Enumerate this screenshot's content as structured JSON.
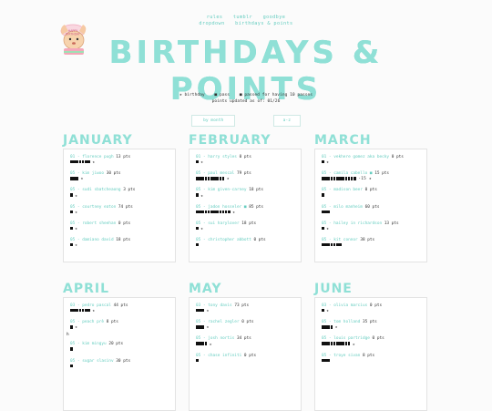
{
  "nav": {
    "row1": [
      "rules",
      "tumblr",
      "goodbye"
    ],
    "row2": [
      "dropdown",
      "birthdays & points"
    ]
  },
  "title": "BIRTHDAYS & POINTS",
  "legend": {
    "items": [
      "★ birthday",
      "■ pass",
      "■ passed for having 10 passes"
    ],
    "updated": "points updated as of: 01/26"
  },
  "buttons": [
    "by month",
    "a-z"
  ],
  "months": [
    {
      "name": "JANUARY",
      "entries": [
        {
          "date": "01",
          "name": "florence pugh",
          "pts": "13 pts",
          "squares": 7,
          "extra": "★"
        },
        {
          "date": "05",
          "name": "kim jiwoo",
          "pts": "30 pts",
          "squares": 3,
          "extra": "★"
        },
        {
          "date": "05",
          "name": "sudi sbatcheaong",
          "pts": "3 pts",
          "squares": 1,
          "extra": "★"
        },
        {
          "date": "05",
          "name": "courtney eaton",
          "pts": "74 pts",
          "squares": 1,
          "extra": "★"
        },
        {
          "date": "05",
          "name": "robert sheehan",
          "pts": "0 pts",
          "squares": 1,
          "extra": "★"
        },
        {
          "date": "05",
          "name": "damiano david",
          "pts": "18 pts",
          "squares": 1,
          "extra": "★"
        }
      ]
    },
    {
      "name": "FEBRUARY",
      "entries": [
        {
          "date": "01",
          "name": "harry styles",
          "pts": "0 pts",
          "squares": 1,
          "extra": "★"
        },
        {
          "date": "05",
          "name": "paul mescal",
          "pts": "79 pts",
          "squares": 10,
          "extra": "★"
        },
        {
          "date": "05",
          "name": "kim given-carney",
          "pts": "18 pts",
          "squares": 1,
          "extra": "★"
        },
        {
          "date": "05",
          "name": "jadon hosseler ■",
          "pts": "85 pts",
          "squares": 12,
          "extra": "★"
        },
        {
          "date": "05",
          "name": "sui harylover",
          "pts": "18 pts",
          "squares": 1,
          "extra": "★"
        },
        {
          "date": "05",
          "name": "christopher abbott",
          "pts": "0 pts",
          "squares": 1,
          "extra": ""
        }
      ]
    },
    {
      "name": "MARCH",
      "entries": [
        {
          "date": "01",
          "name": "vekhere gomez aka becky",
          "pts": "0 pts",
          "squares": 1,
          "extra": "★"
        },
        {
          "date": "05",
          "name": "camila cabello ■",
          "pts": "15 pts",
          "squares": 12,
          "extra": "-15 ★"
        },
        {
          "date": "05",
          "name": "madison beer",
          "pts": "0 pts",
          "squares": 1,
          "extra": ""
        },
        {
          "date": "05",
          "name": "milo manheim",
          "pts": "60 pts",
          "squares": 3,
          "extra": ""
        },
        {
          "date": "05",
          "name": "hailey in richardson",
          "pts": "13 pts",
          "squares": 1,
          "extra": "★"
        },
        {
          "date": "05",
          "name": "kit connor",
          "pts": "38 pts",
          "squares": 7,
          "extra": ""
        }
      ]
    },
    {
      "name": "APRIL",
      "entries": [
        {
          "date": "03",
          "name": "pedro pascal",
          "pts": "44 pts",
          "squares": 7,
          "extra": "★"
        },
        {
          "date": "05",
          "name": "peach prè",
          "pts": "8 pts",
          "squares": 1,
          "extra": "★"
        },
        {
          "date": "05",
          "name": "kim mingyu",
          "pts": "20 pts",
          "squares": 1,
          "extra": "",
          "stray": "h"
        },
        {
          "date": "05",
          "name": "sugar slasinv",
          "pts": "30 pts",
          "squares": 1,
          "extra": ""
        }
      ]
    },
    {
      "name": "MAY",
      "entries": [
        {
          "date": "03",
          "name": "tony davis",
          "pts": "73 pts",
          "squares": 3,
          "extra": "★"
        },
        {
          "date": "05",
          "name": "rachel zegler",
          "pts": "0 pts",
          "squares": 3,
          "extra": "★"
        },
        {
          "date": "05",
          "name": "josh nortis",
          "pts": "34 pts",
          "squares": 4,
          "extra": "★"
        },
        {
          "date": "05",
          "name": "chase infiniti",
          "pts": "0 pts",
          "squares": 1,
          "extra": ""
        }
      ]
    },
    {
      "name": "JUNE",
      "entries": [
        {
          "date": "03",
          "name": "olivia marcius",
          "pts": "0 pts",
          "squares": 1,
          "extra": "★"
        },
        {
          "date": "05",
          "name": "tom holland",
          "pts": "35 pts",
          "squares": 4,
          "extra": "★"
        },
        {
          "date": "05",
          "name": "louis partridge",
          "pts": "0 pts",
          "squares": 10,
          "extra": "★"
        },
        {
          "date": "05",
          "name": "troye sivan",
          "pts": "8 pts",
          "squares": 3,
          "extra": ""
        }
      ]
    }
  ]
}
